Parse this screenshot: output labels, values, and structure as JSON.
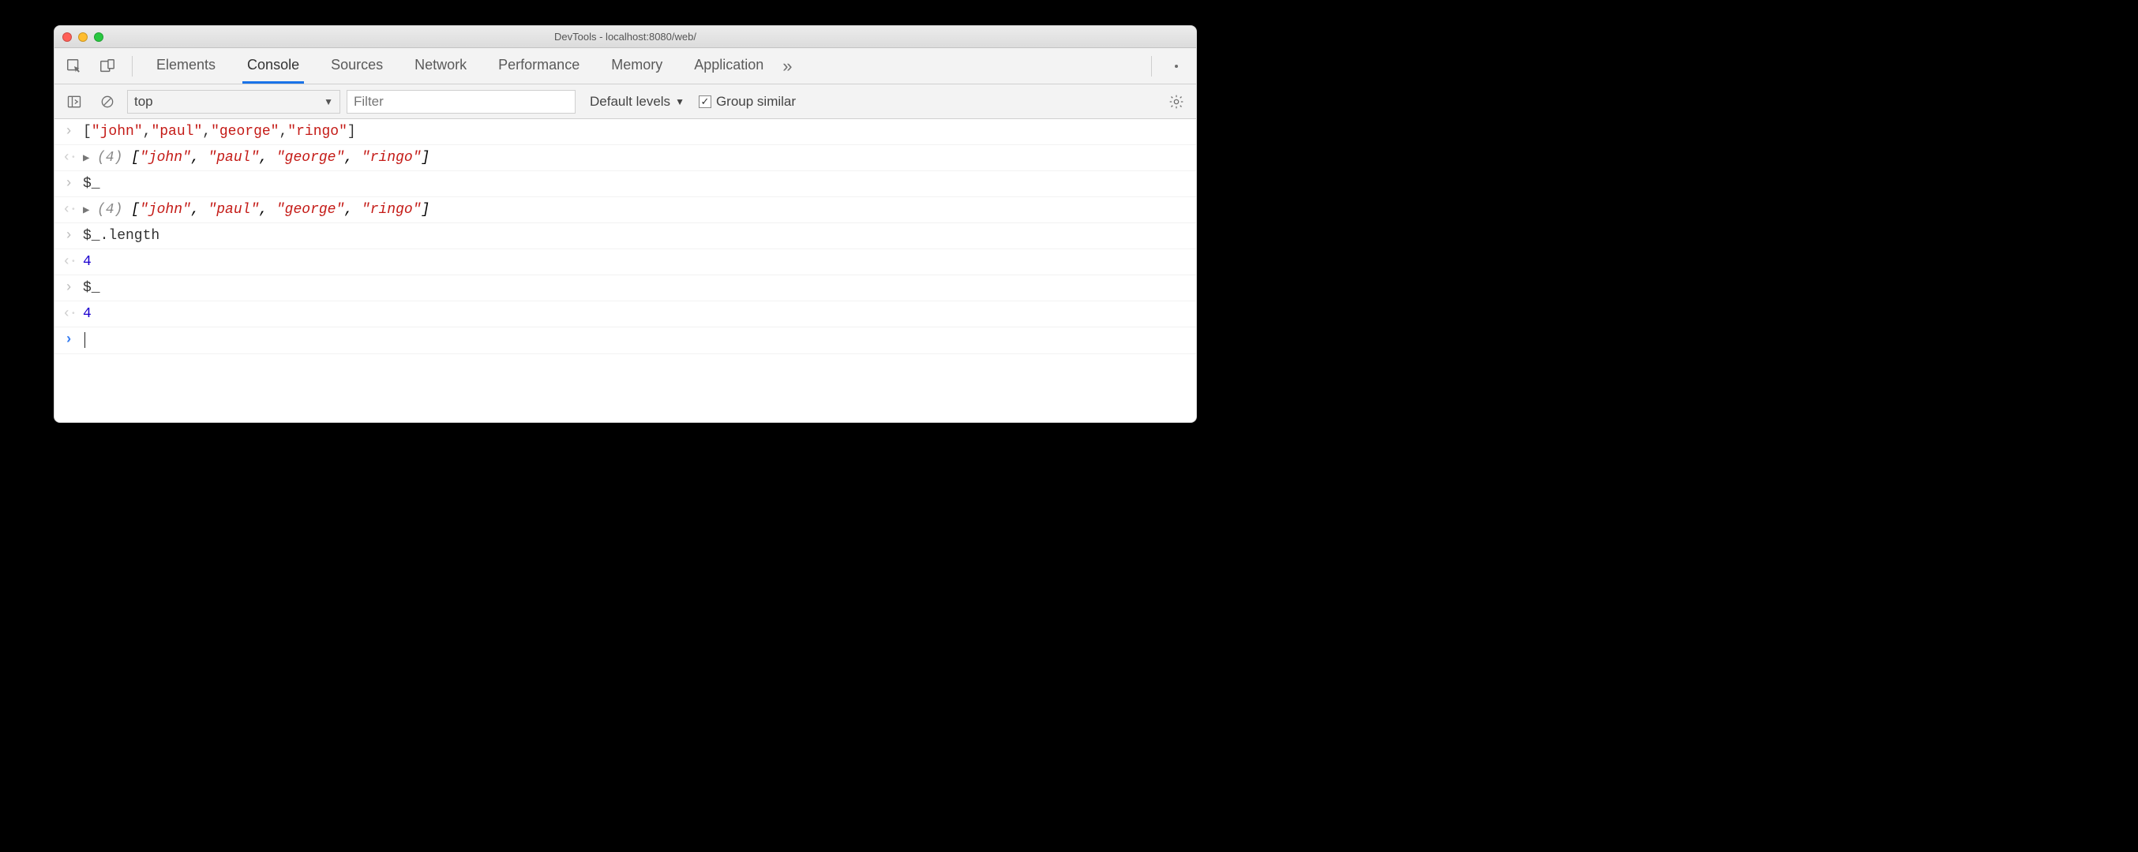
{
  "window": {
    "title": "DevTools - localhost:8080/web/"
  },
  "tabs": {
    "items": [
      "Elements",
      "Console",
      "Sources",
      "Network",
      "Performance",
      "Memory",
      "Application"
    ],
    "active_index": 1,
    "overflow_glyph": "»"
  },
  "filterbar": {
    "context": "top",
    "filter_placeholder": "Filter",
    "levels_label": "Default levels",
    "group_similar_label": "Group similar",
    "group_similar_checked": true
  },
  "console": {
    "rows": [
      {
        "kind": "input",
        "tokens": [
          {
            "t": "[",
            "c": "sym"
          },
          {
            "t": "\"john\"",
            "c": "str"
          },
          {
            "t": ",",
            "c": "sym"
          },
          {
            "t": "\"paul\"",
            "c": "str"
          },
          {
            "t": ",",
            "c": "sym"
          },
          {
            "t": "\"george\"",
            "c": "str"
          },
          {
            "t": ",",
            "c": "sym"
          },
          {
            "t": "\"ringo\"",
            "c": "str"
          },
          {
            "t": "]",
            "c": "sym"
          }
        ]
      },
      {
        "kind": "output",
        "expandable": true,
        "meta": "(4) ",
        "tokens": [
          {
            "t": "[",
            "c": "italic"
          },
          {
            "t": "\"john\"",
            "c": "strI"
          },
          {
            "t": ", ",
            "c": "italic"
          },
          {
            "t": "\"paul\"",
            "c": "strI"
          },
          {
            "t": ", ",
            "c": "italic"
          },
          {
            "t": "\"george\"",
            "c": "strI"
          },
          {
            "t": ", ",
            "c": "italic"
          },
          {
            "t": "\"ringo\"",
            "c": "strI"
          },
          {
            "t": "]",
            "c": "italic"
          }
        ]
      },
      {
        "kind": "input",
        "tokens": [
          {
            "t": "$_",
            "c": "sym"
          }
        ]
      },
      {
        "kind": "output",
        "expandable": true,
        "meta": "(4) ",
        "tokens": [
          {
            "t": "[",
            "c": "italic"
          },
          {
            "t": "\"john\"",
            "c": "strI"
          },
          {
            "t": ", ",
            "c": "italic"
          },
          {
            "t": "\"paul\"",
            "c": "strI"
          },
          {
            "t": ", ",
            "c": "italic"
          },
          {
            "t": "\"george\"",
            "c": "strI"
          },
          {
            "t": ", ",
            "c": "italic"
          },
          {
            "t": "\"ringo\"",
            "c": "strI"
          },
          {
            "t": "]",
            "c": "italic"
          }
        ]
      },
      {
        "kind": "input",
        "tokens": [
          {
            "t": "$_.length",
            "c": "sym"
          }
        ]
      },
      {
        "kind": "output",
        "tokens": [
          {
            "t": "4",
            "c": "num"
          }
        ]
      },
      {
        "kind": "input",
        "tokens": [
          {
            "t": "$_",
            "c": "sym"
          }
        ]
      },
      {
        "kind": "output",
        "tokens": [
          {
            "t": "4",
            "c": "num"
          }
        ]
      },
      {
        "kind": "prompt"
      }
    ]
  },
  "glyphs": {
    "input": "›",
    "output": "‹·",
    "expander": "▶"
  }
}
